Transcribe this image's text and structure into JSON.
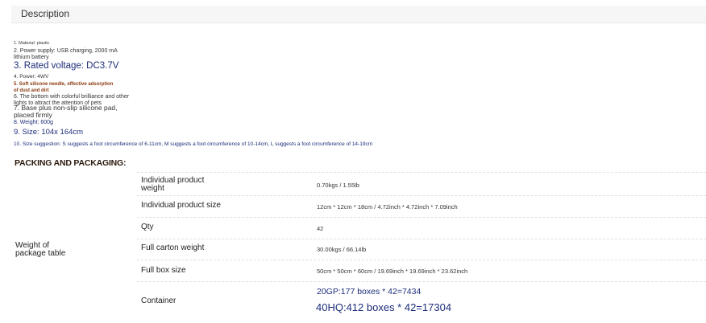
{
  "description_tab": {
    "label": "Description"
  },
  "specs": {
    "s1": "1. Material: plastic",
    "s2a": "2. Power supply: USB charging, 2000 mA",
    "s2b": "lithium battery",
    "s3": "3. Rated voltage: DC3.7V",
    "s4": "4. Power: 4WV",
    "s5a": "5. Soft silicone needle, effective adsorption",
    "s5b": "of dust and dirt",
    "s6a": "6. The bottom with colorful brilliance and other",
    "s6b": "lights to attract the attention of pets",
    "s7a": "7. Base plus non-slip silicone pad,",
    "s7b": "placed firmly",
    "s8": "8. Weight: 600g",
    "s9": "9. Size: 104x 164cm",
    "s10": "10. Size suggestion: S suggests a foot circumference of 6-11cm, M suggests a foot circumference of 10-14cm, L suggests a foot circumference of 14-19cm"
  },
  "packing": {
    "heading": "PACKING AND PACKAGING:",
    "group_label_1": "Weight of",
    "group_label_2": "package table",
    "rows": [
      {
        "label_1": "Individual product",
        "label_2": "weight",
        "value": "0.70kgs / 1.55lb"
      },
      {
        "label": "Individual product size",
        "value": "12cm * 12cm * 18cm / 4.72inch * 4.72inch * 7.09inch"
      },
      {
        "label": "Qty",
        "value": "42"
      },
      {
        "label": "Full carton weight",
        "value": "30.00kgs / 66.14lb"
      },
      {
        "label": "Full box size",
        "value": "50cm * 50cm * 60cm / 19.69inch * 19.69inch * 23.62inch"
      },
      {
        "label": "Container",
        "value_1": "20GP:177 boxes * 42=7434",
        "value_2": "40HQ:412 boxes * 42=17304"
      }
    ]
  }
}
